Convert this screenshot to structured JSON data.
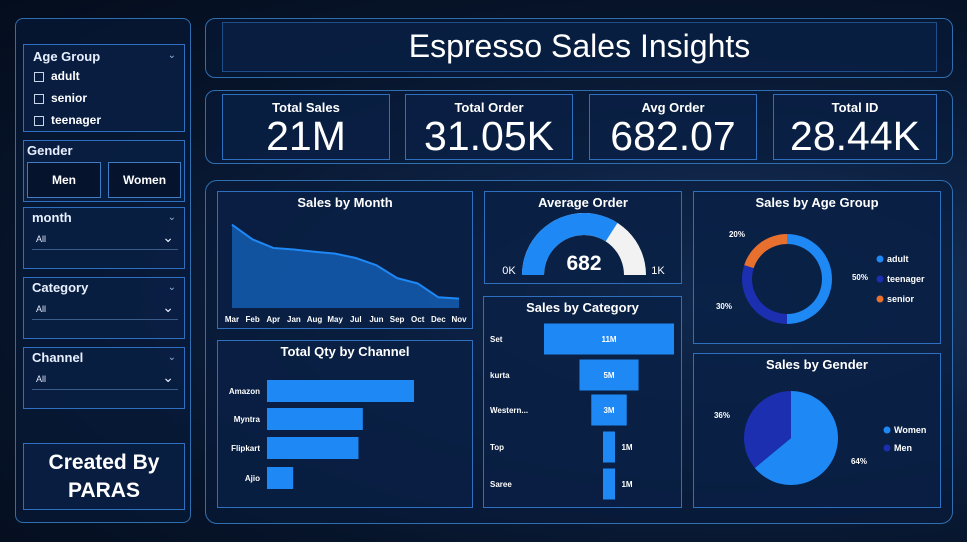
{
  "title": "Espresso Sales Insights",
  "sidebar": {
    "age_group": {
      "label": "Age Group",
      "options": [
        "adult",
        "senior",
        "teenager"
      ]
    },
    "gender": {
      "label": "Gender",
      "buttons": [
        "Men",
        "Women"
      ]
    },
    "month": {
      "label": "month",
      "value": "All"
    },
    "category": {
      "label": "Category",
      "value": "All"
    },
    "channel": {
      "label": "Channel",
      "value": "All"
    },
    "credit": {
      "line1": "Created By",
      "line2": "PARAS"
    }
  },
  "kpis": [
    {
      "label": "Total Sales",
      "value": "21M"
    },
    {
      "label": "Total Order",
      "value": "31.05K"
    },
    {
      "label": "Avg Order",
      "value": "682.07"
    },
    {
      "label": "Total ID",
      "value": "28.44K"
    }
  ],
  "colors": {
    "primary": "#1e88f5",
    "navy": "#1b2fb0",
    "orange": "#e8702e",
    "gauge_bg": "#f2f2f2"
  },
  "chart_data": [
    {
      "type": "area",
      "title": "Sales by Month",
      "categories": [
        "Mar",
        "Feb",
        "Apr",
        "Jan",
        "Aug",
        "May",
        "Jul",
        "Jun",
        "Sep",
        "Oct",
        "Dec",
        "Nov"
      ],
      "values": [
        2.65,
        2.18,
        1.91,
        1.86,
        1.79,
        1.73,
        1.59,
        1.36,
        0.95,
        0.78,
        0.34,
        0.3
      ]
    },
    {
      "type": "gauge",
      "title": "Average Order",
      "value": 682,
      "value_label": "682",
      "min_label": "0K",
      "max_label": "1K",
      "min": 0,
      "max": 1000
    },
    {
      "type": "pie",
      "title": "Sales by Age Group",
      "donut": true,
      "slices": [
        {
          "label": "adult",
          "value": 50,
          "value_label": "50%",
          "color": "#1e88f5"
        },
        {
          "label": "teenager",
          "value": 30,
          "value_label": "30%",
          "color": "#1b2fb0"
        },
        {
          "label": "senior",
          "value": 20,
          "value_label": "20%",
          "color": "#e8702e"
        }
      ],
      "legend": "right"
    },
    {
      "type": "bar",
      "orientation": "horizontal",
      "title": "Total Qty by Channel",
      "categories": [
        "Amazon",
        "Myntra",
        "Flipkart",
        "Ajio"
      ],
      "values": [
        13500,
        8800,
        8400,
        2400
      ]
    },
    {
      "type": "bar",
      "orientation": "funnel",
      "title": "Sales by Category",
      "categories": [
        "Set",
        "kurta",
        "Western...",
        "Top",
        "Saree"
      ],
      "values": [
        11,
        5,
        3,
        1,
        1
      ],
      "value_labels": [
        "11M",
        "5M",
        "3M",
        "1M",
        "1M"
      ]
    },
    {
      "type": "pie",
      "title": "Sales by Gender",
      "slices": [
        {
          "label": "Women",
          "value": 64,
          "value_label": "64%",
          "color": "#1e88f5"
        },
        {
          "label": "Men",
          "value": 36,
          "value_label": "36%",
          "color": "#1b2fb0"
        }
      ],
      "legend": "right"
    }
  ]
}
